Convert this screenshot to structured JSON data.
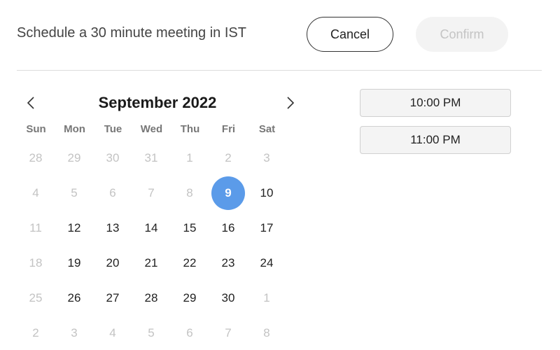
{
  "header": {
    "title": "Schedule a 30 minute meeting in IST",
    "cancel_label": "Cancel",
    "confirm_label": "Confirm"
  },
  "calendar": {
    "month_label": "September 2022",
    "prev_icon": "chevron-left-icon",
    "next_icon": "chevron-right-icon",
    "weekdays": [
      "Sun",
      "Mon",
      "Tue",
      "Wed",
      "Thu",
      "Fri",
      "Sat"
    ],
    "selected_color": "#5b9be9",
    "weeks": [
      [
        {
          "d": "28",
          "s": "other"
        },
        {
          "d": "29",
          "s": "other"
        },
        {
          "d": "30",
          "s": "other"
        },
        {
          "d": "31",
          "s": "other"
        },
        {
          "d": "1",
          "s": "disabled"
        },
        {
          "d": "2",
          "s": "disabled"
        },
        {
          "d": "3",
          "s": "disabled"
        }
      ],
      [
        {
          "d": "4",
          "s": "disabled"
        },
        {
          "d": "5",
          "s": "disabled"
        },
        {
          "d": "6",
          "s": "disabled"
        },
        {
          "d": "7",
          "s": "disabled"
        },
        {
          "d": "8",
          "s": "disabled"
        },
        {
          "d": "9",
          "s": "sel"
        },
        {
          "d": "10",
          "s": "cur"
        }
      ],
      [
        {
          "d": "11",
          "s": "disabled"
        },
        {
          "d": "12",
          "s": "cur"
        },
        {
          "d": "13",
          "s": "cur"
        },
        {
          "d": "14",
          "s": "cur"
        },
        {
          "d": "15",
          "s": "cur"
        },
        {
          "d": "16",
          "s": "cur"
        },
        {
          "d": "17",
          "s": "cur"
        }
      ],
      [
        {
          "d": "18",
          "s": "disabled"
        },
        {
          "d": "19",
          "s": "cur"
        },
        {
          "d": "20",
          "s": "cur"
        },
        {
          "d": "21",
          "s": "cur"
        },
        {
          "d": "22",
          "s": "cur"
        },
        {
          "d": "23",
          "s": "cur"
        },
        {
          "d": "24",
          "s": "cur"
        }
      ],
      [
        {
          "d": "25",
          "s": "disabled"
        },
        {
          "d": "26",
          "s": "cur"
        },
        {
          "d": "27",
          "s": "cur"
        },
        {
          "d": "28",
          "s": "cur"
        },
        {
          "d": "29",
          "s": "cur"
        },
        {
          "d": "30",
          "s": "cur"
        },
        {
          "d": "1",
          "s": "other"
        }
      ],
      [
        {
          "d": "2",
          "s": "other"
        },
        {
          "d": "3",
          "s": "other"
        },
        {
          "d": "4",
          "s": "other"
        },
        {
          "d": "5",
          "s": "other"
        },
        {
          "d": "6",
          "s": "other"
        },
        {
          "d": "7",
          "s": "other"
        },
        {
          "d": "8",
          "s": "other"
        }
      ]
    ]
  },
  "time_slots": [
    "10:00 PM",
    "11:00 PM"
  ]
}
